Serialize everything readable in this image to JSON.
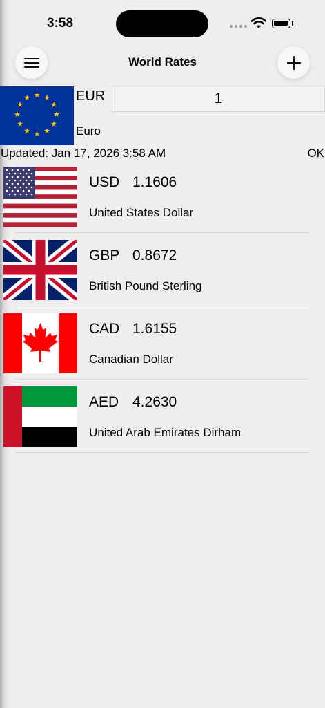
{
  "status_bar": {
    "time": "3:58",
    "icons": [
      "signal-dots-icon",
      "wifi-icon",
      "battery-icon"
    ]
  },
  "nav": {
    "title": "World Rates",
    "menu_icon": "hamburger-menu-icon",
    "add_icon": "plus-icon"
  },
  "base": {
    "code": "EUR",
    "name": "Euro",
    "amount": "1",
    "flag": "eu-flag-icon"
  },
  "status": {
    "updated": "Updated: Jan 17, 2026 3:58 AM",
    "ok": "OK"
  },
  "rates": [
    {
      "code": "USD",
      "rate": "1.1606",
      "name": "United States Dollar",
      "flag": "us-flag-icon"
    },
    {
      "code": "GBP",
      "rate": "0.8672",
      "name": "British Pound Sterling",
      "flag": "uk-flag-icon"
    },
    {
      "code": "CAD",
      "rate": "1.6155",
      "name": "Canadian Dollar",
      "flag": "canada-flag-icon"
    },
    {
      "code": "AED",
      "rate": "4.2630",
      "name": "United Arab Emirates Dirham",
      "flag": "uae-flag-icon"
    }
  ],
  "colors": {
    "background": "#efedee",
    "eu_blue": "#003399",
    "eu_gold": "#ffcc00",
    "us_red": "#b22234",
    "us_blue": "#3c3b6e",
    "uk_blue": "#012169",
    "uk_red": "#c8102e",
    "ca_red": "#ff0000",
    "ae_green": "#009639",
    "ae_red": "#ce1126"
  }
}
